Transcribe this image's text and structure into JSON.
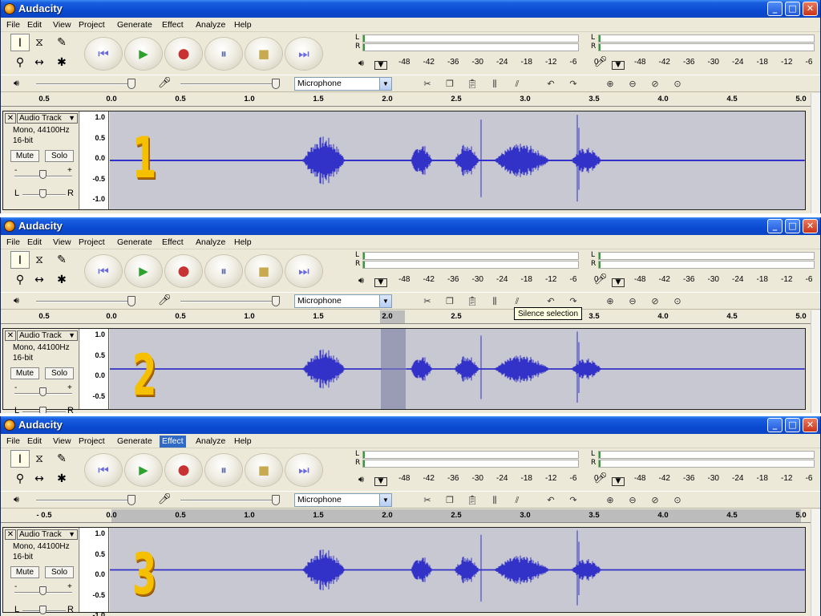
{
  "windows": [
    {
      "title": "Audacity",
      "step_label": "1",
      "active_menu": "",
      "ruler_ticks": [
        "0.5",
        "0.0",
        "0.5",
        "1.0",
        "1.5",
        "2.0",
        "2.5",
        "3.0",
        "3.5",
        "4.0",
        "4.5",
        "5.0"
      ],
      "selection_start": null,
      "selection_end": null
    },
    {
      "title": "Audacity",
      "step_label": "2",
      "active_menu": "",
      "ruler_ticks": [
        "0.5",
        "0.0",
        "0.5",
        "1.0",
        "1.5",
        "2.0",
        "2.5",
        "3.0",
        "3.5",
        "4.0",
        "4.5",
        "5.0"
      ],
      "selection_start": 1.95,
      "selection_end": 2.13,
      "tooltip": "Silence selection"
    },
    {
      "title": "Audacity",
      "step_label": "3",
      "active_menu": "Effect",
      "ruler_ticks": [
        "- 0.5",
        "0.0",
        "0.5",
        "1.0",
        "1.5",
        "2.0",
        "2.5",
        "3.0",
        "3.5",
        "4.0",
        "4.5",
        "5.0"
      ],
      "selection_start": 0.0,
      "selection_end": 5.0
    }
  ],
  "menus": [
    "File",
    "Edit",
    "View",
    "Project",
    "Generate",
    "Effect",
    "Analyze",
    "Help"
  ],
  "title_buttons": {
    "minimize": "_",
    "maximize": "□",
    "close": "✕"
  },
  "meter": {
    "left_label": "L",
    "right_label": "R",
    "scale": [
      "-48",
      "-42",
      "-36",
      "-30",
      "-24",
      "-18",
      "-12",
      "-6",
      "0"
    ]
  },
  "input_source": "Microphone",
  "track": {
    "name": "Audio Track",
    "format_line1": "Mono, 44100Hz",
    "format_line2": "16-bit",
    "mute": "Mute",
    "solo": "Solo",
    "gain_minus": "-",
    "gain_plus": "+",
    "pan_left": "L",
    "pan_right": "R",
    "close": "✕"
  },
  "vruler": [
    "1.0",
    "0.5",
    "0.0",
    "-0.5",
    "-1.0"
  ],
  "icons": {
    "skip_start": "⏮",
    "play": "▶",
    "record": "●",
    "pause": "⏸",
    "stop": "■",
    "skip_end": "⏭"
  },
  "colors": {
    "title_blue": "#0a4ad2",
    "waveform": "#3232c8",
    "wave_bg": "#c8c8d2",
    "number_gold": "#f5c000",
    "play_green": "#2ea02e",
    "record_red": "#c83232"
  }
}
